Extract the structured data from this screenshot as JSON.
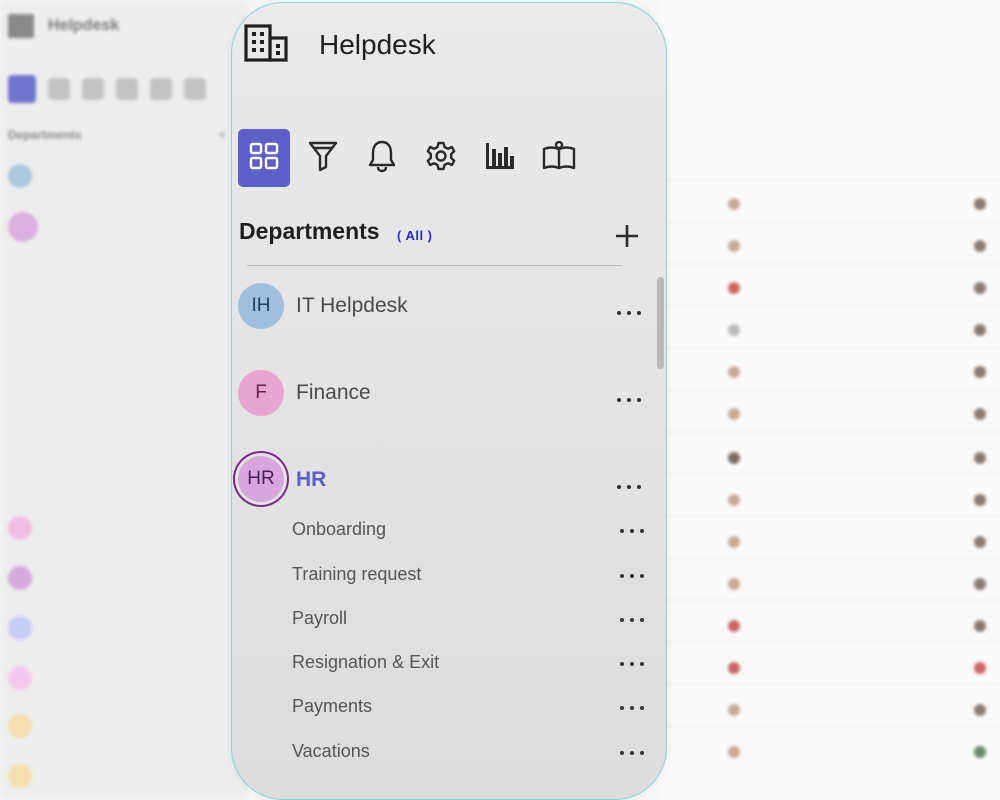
{
  "app": {
    "title": "Helpdesk"
  },
  "toolbar": {
    "items": [
      {
        "icon": "dashboard-icon",
        "active": true
      },
      {
        "icon": "filter-icon",
        "active": false
      },
      {
        "icon": "bell-icon",
        "active": false
      },
      {
        "icon": "gear-icon",
        "active": false
      },
      {
        "icon": "bar-chart-icon",
        "active": false
      },
      {
        "icon": "book-icon",
        "active": false
      }
    ]
  },
  "departments": {
    "title": "Departments",
    "filter": "( All )",
    "items": [
      {
        "initials": "IH",
        "name": "IT Helpdesk",
        "avatar_color": "#9fbfdc",
        "text_color": "#1f3d5c"
      },
      {
        "initials": "F",
        "name": "Finance",
        "avatar_color": "#e8a5d0",
        "text_color": "#6b1f4a"
      },
      {
        "initials": "HR",
        "name": "HR",
        "avatar_color": "#d6a6dc",
        "text_color": "#4a1f55",
        "selected": true
      }
    ],
    "hr_children": [
      "Onboarding",
      "Training request",
      "Payroll",
      "Resignation & Exit",
      "Payments",
      "Vacations"
    ]
  },
  "colors": {
    "accent": "#5b5fc7",
    "selected_text": "#5b5fc7",
    "panel_border": "#8fd0dc"
  }
}
